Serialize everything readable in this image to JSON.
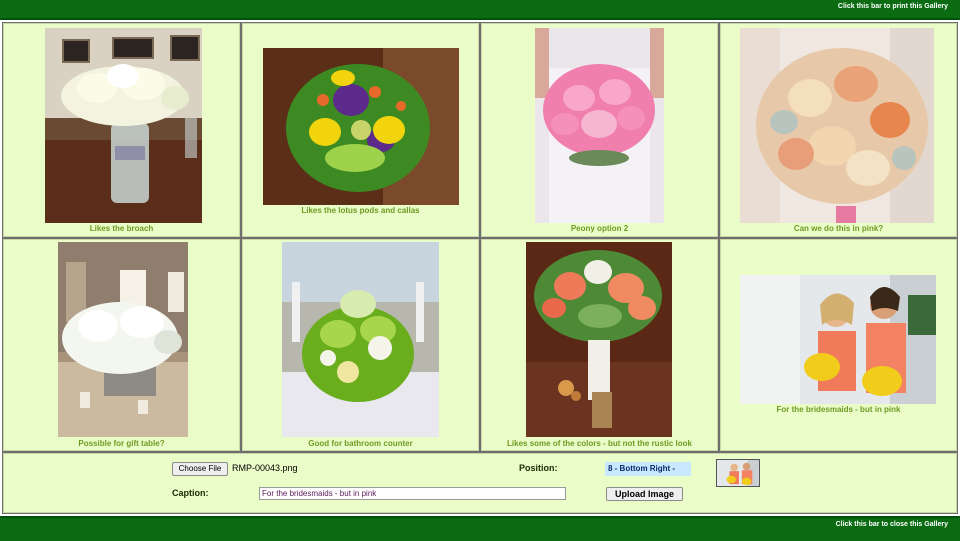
{
  "header": {
    "print_bar": "Click this bar to print this Gallery"
  },
  "footer": {
    "close_bar": "Click this bar to close this Gallery"
  },
  "gallery": [
    {
      "caption": "Likes the broach"
    },
    {
      "caption": "Likes the lotus pods and callas"
    },
    {
      "caption": "Peony option 2"
    },
    {
      "caption": "Can we do this in pink?"
    },
    {
      "caption": "Possible for gift table?"
    },
    {
      "caption": "Good for bathroom counter"
    },
    {
      "caption": "Likes some of the colors - but not the rustic look"
    },
    {
      "caption": "For the bridesmaids - but in pink"
    }
  ],
  "form": {
    "choose_file_label": "Choose File",
    "file_name": "RMP-00043.png",
    "position_label": "Position:",
    "position_value": "8 - Bottom Right -",
    "caption_label": "Caption:",
    "caption_value": "For the bridesmaids - but in pink",
    "upload_label": "Upload Image"
  },
  "colors": {
    "bar_green": "#0a6b12",
    "cell_bg": "#eafdc8",
    "caption_green": "#6f9a23"
  }
}
